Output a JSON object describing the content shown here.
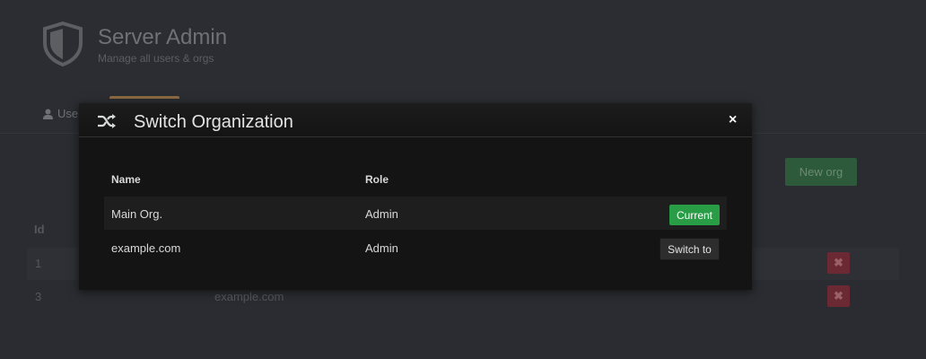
{
  "page": {
    "title": "Server Admin",
    "subtitle": "Manage all users & orgs",
    "tabs": [
      {
        "label": "Use"
      }
    ],
    "new_org_label": "New org",
    "table": {
      "id_header": "Id",
      "rows": [
        {
          "id": "1",
          "name": ""
        },
        {
          "id": "3",
          "name": "example.com"
        }
      ],
      "delete_glyph": "✖"
    }
  },
  "modal": {
    "icon": "shuffle-icon",
    "title": "Switch Organization",
    "close_glyph": "×",
    "columns": {
      "name": "Name",
      "role": "Role"
    },
    "rows": [
      {
        "name": "Main Org.",
        "role": "Admin",
        "action": "Current"
      },
      {
        "name": "example.com",
        "role": "Admin",
        "action": "Switch to"
      }
    ]
  },
  "colors": {
    "accent_green": "#299c46",
    "modal_bg": "#141414",
    "page_bg": "#2a2c31"
  }
}
